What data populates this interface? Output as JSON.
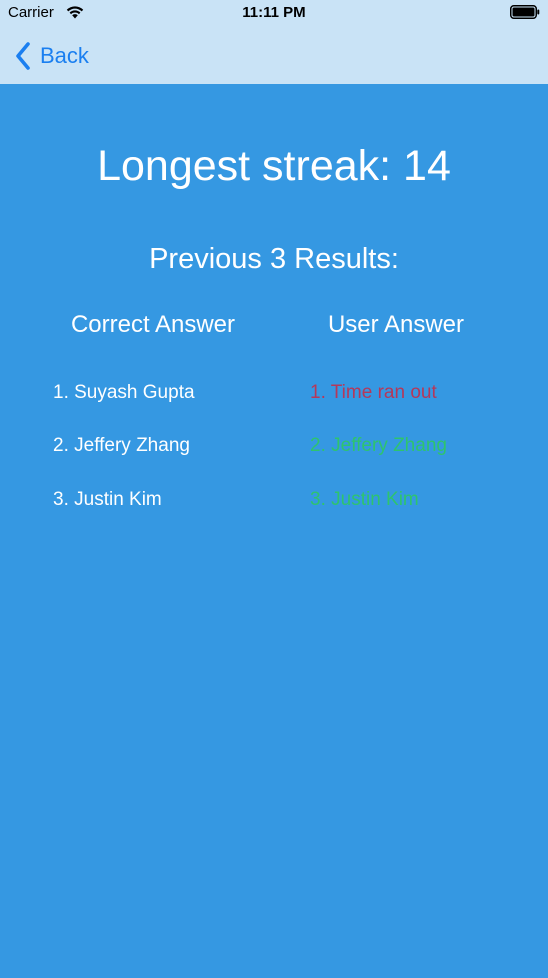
{
  "status_bar": {
    "carrier": "Carrier",
    "time": "11:11 PM",
    "icons": [
      "wifi-icon",
      "battery-icon"
    ]
  },
  "nav_bar": {
    "back_label": "Back",
    "accent_color": "#1a7ff0"
  },
  "main": {
    "streak_text": "Longest streak: 14",
    "results_heading": "Previous 3 Results:",
    "columns": {
      "correct_header": "Correct Answer",
      "user_header": "User Answer"
    },
    "correct_answers": [
      "1. Suyash Gupta",
      "2. Jeffery Zhang",
      "3. Justin Kim"
    ],
    "user_answers": [
      {
        "text": "1. Time ran out",
        "status": "incorrect",
        "color": "#b5385a"
      },
      {
        "text": "2. Jeffery Zhang",
        "status": "correct",
        "color": "#2ec46e"
      },
      {
        "text": "3. Justin Kim",
        "status": "correct",
        "color": "#2ec46e"
      }
    ]
  },
  "colors": {
    "background": "#3598e2",
    "header_background": "#c9e3f6",
    "text": "#ffffff"
  }
}
